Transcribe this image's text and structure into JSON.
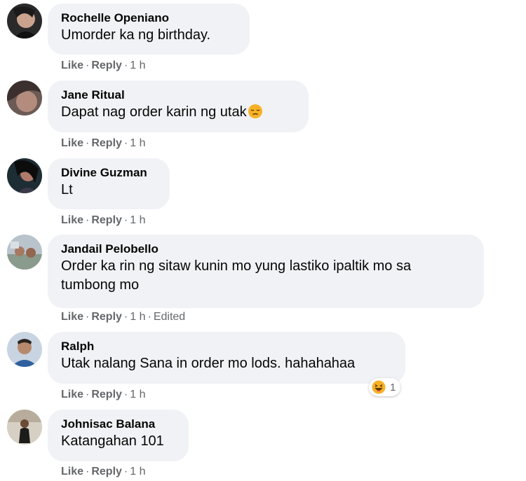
{
  "comments": [
    {
      "author": "Rochelle Openiano",
      "text": "Umorder ka ng birthday.",
      "like": "Like",
      "reply": "Reply",
      "time": "1 h",
      "avatar": "avatar-rochelle"
    },
    {
      "author": "Jane Ritual",
      "text": "Dapat nag order karin ng utak",
      "emoji": "pensive-face-icon",
      "like": "Like",
      "reply": "Reply",
      "time": "1 h",
      "avatar": "avatar-jane"
    },
    {
      "author": "Divine Guzman",
      "text": "Lt",
      "like": "Like",
      "reply": "Reply",
      "time": "1 h",
      "avatar": "avatar-divine"
    },
    {
      "author": "Jandail Pelobello",
      "text_line1": "Order ka rin ng sitaw kunin mo yung lastiko ipaltik mo sa",
      "text_line2": "tumbong mo",
      "like": "Like",
      "reply": "Reply",
      "time": "1 h",
      "edited": "Edited",
      "avatar": "avatar-jandail"
    },
    {
      "author": "Ralph",
      "text": "Utak nalang Sana in order mo lods. hahahahaa",
      "like": "Like",
      "reply": "Reply",
      "time": "1 h",
      "reaction_icon": "haha-reaction-icon",
      "reaction_count": "1",
      "avatar": "avatar-ralph"
    },
    {
      "author": "Johnisac Balana",
      "text": "Katangahan 101",
      "like": "Like",
      "reply": "Reply",
      "time": "1 h",
      "avatar": "avatar-johnisac"
    }
  ],
  "separator": "·",
  "colors": {
    "bubble": "#f0f2f5",
    "meta_text": "#65676b",
    "author_text": "#050505",
    "emoji_yellow": "#f7b125"
  }
}
